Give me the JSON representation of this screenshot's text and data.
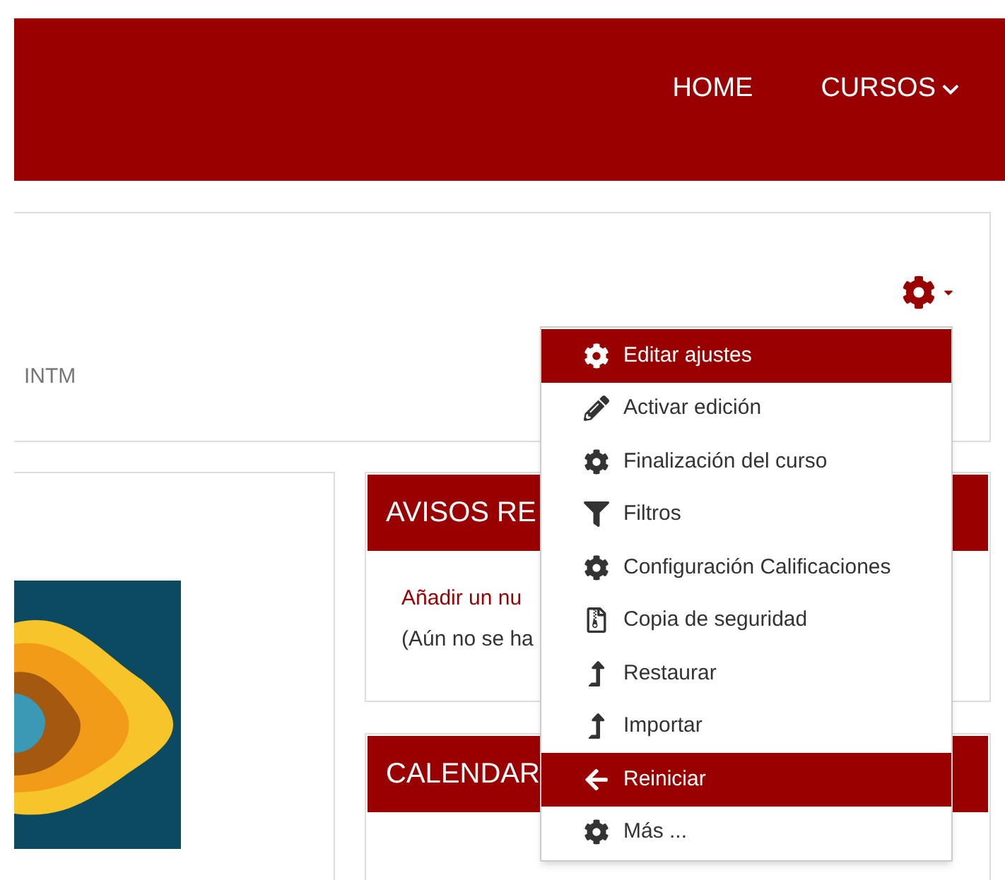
{
  "navbar": {
    "links": [
      {
        "label": "HOME",
        "dropdown": false
      },
      {
        "label": "CURSOS",
        "dropdown": true
      }
    ]
  },
  "course_header": {
    "subtitle": "INTM"
  },
  "settings_menu": {
    "items": [
      {
        "label": "Editar ajustes",
        "highlighted": true
      },
      {
        "label": "Activar edición",
        "highlighted": false
      },
      {
        "label": "Finalización del curso",
        "highlighted": false
      },
      {
        "label": "Filtros",
        "highlighted": false
      },
      {
        "label": "Configuración Calificaciones",
        "highlighted": false
      },
      {
        "label": "Copia de seguridad",
        "highlighted": false
      },
      {
        "label": "Restaurar",
        "highlighted": false
      },
      {
        "label": "Importar",
        "highlighted": false
      },
      {
        "label": "Reiniciar",
        "highlighted": true
      },
      {
        "label": "Más ...",
        "highlighted": false
      }
    ]
  },
  "blocks": [
    {
      "title": "AVISOS RE",
      "link": "Añadir un nu",
      "note": "(Aún no se ha"
    },
    {
      "title": "CALENDAR"
    }
  ]
}
